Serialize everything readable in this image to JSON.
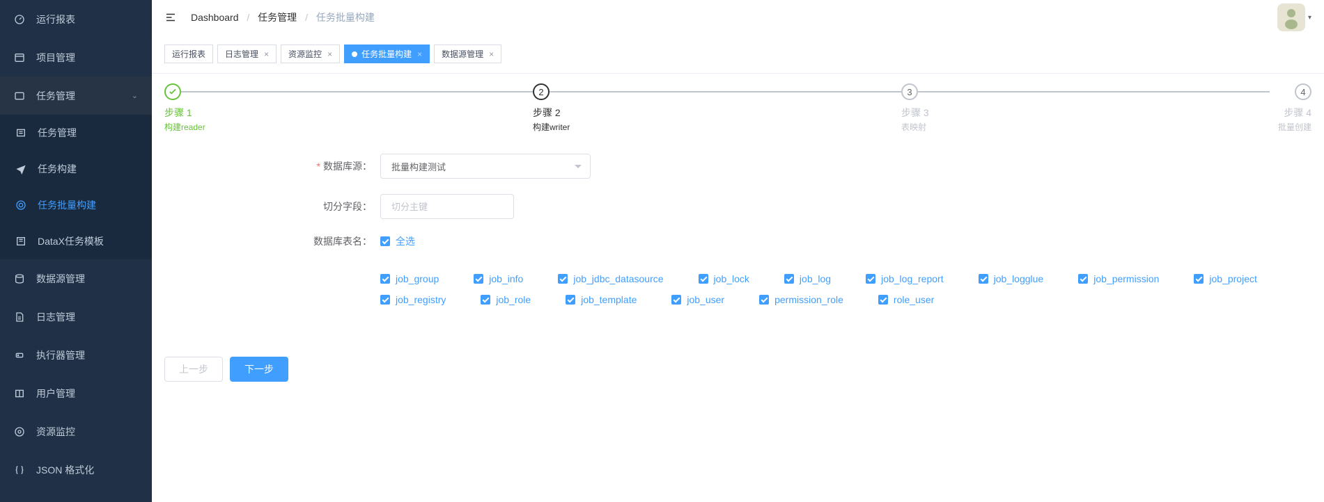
{
  "header": {
    "breadcrumb": [
      "Dashboard",
      "任务管理",
      "任务批量构建"
    ]
  },
  "sidebar": {
    "items": [
      {
        "label": "运行报表",
        "icon": "dashboard"
      },
      {
        "label": "项目管理",
        "icon": "project"
      },
      {
        "label": "任务管理",
        "icon": "task",
        "expanded": true,
        "children": [
          {
            "label": "任务管理",
            "icon": "list"
          },
          {
            "label": "任务构建",
            "icon": "plane"
          },
          {
            "label": "任务批量构建",
            "icon": "batch",
            "active": true
          },
          {
            "label": "DataX任务模板",
            "icon": "template"
          }
        ]
      },
      {
        "label": "数据源管理",
        "icon": "datasource"
      },
      {
        "label": "日志管理",
        "icon": "log"
      },
      {
        "label": "执行器管理",
        "icon": "executor"
      },
      {
        "label": "用户管理",
        "icon": "user"
      },
      {
        "label": "资源监控",
        "icon": "monitor"
      },
      {
        "label": "JSON 格式化",
        "icon": "json"
      }
    ]
  },
  "tabs": [
    {
      "label": "运行报表",
      "closable": false
    },
    {
      "label": "日志管理",
      "closable": true
    },
    {
      "label": "资源监控",
      "closable": true
    },
    {
      "label": "任务批量构建",
      "closable": true,
      "active": true
    },
    {
      "label": "数据源管理",
      "closable": true
    }
  ],
  "steps": [
    {
      "title": "步骤 1",
      "desc": "构建reader",
      "state": "success"
    },
    {
      "title": "步骤 2",
      "desc": "构建writer",
      "state": "process"
    },
    {
      "title": "步骤 3",
      "desc": "表映射",
      "state": "wait"
    },
    {
      "title": "步骤 4",
      "desc": "批量创建",
      "state": "wait"
    }
  ],
  "form": {
    "source_label": "数据库源：",
    "source_value": "批量构建测试",
    "split_label": "切分字段：",
    "split_placeholder": "切分主键",
    "tables_label": "数据库表名：",
    "select_all": "全选",
    "tables": [
      "job_group",
      "job_info",
      "job_jdbc_datasource",
      "job_lock",
      "job_log",
      "job_log_report",
      "job_logglue",
      "job_permission",
      "job_project",
      "job_registry",
      "job_role",
      "job_template",
      "job_user",
      "permission_role",
      "role_user"
    ]
  },
  "buttons": {
    "prev": "上一步",
    "next": "下一步"
  }
}
